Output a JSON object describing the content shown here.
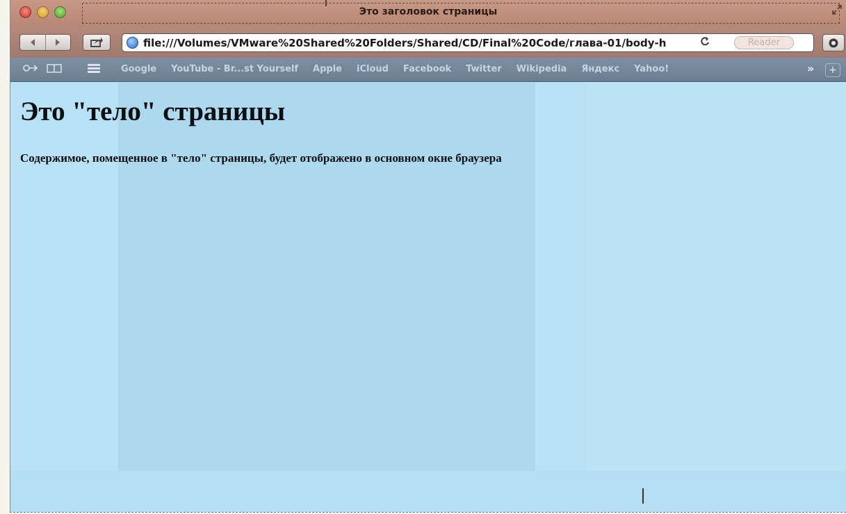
{
  "window": {
    "title": "Это заголовок страницы"
  },
  "toolbar": {
    "back_icon": "back-arrow-icon",
    "forward_icon": "forward-arrow-icon",
    "share_icon": "share-icon",
    "url": "file:///Volumes/VMware%20Shared%20Folders/Shared/CD/Final%20Code/глава-01/body-h",
    "reload_icon": "reload-icon",
    "reader_label": "Reader",
    "extra_icon": "download-icon"
  },
  "bookmarks": {
    "items": [
      {
        "label": "Google"
      },
      {
        "label": "YouTube - Br...st Yourself"
      },
      {
        "label": "Apple"
      },
      {
        "label": "iCloud"
      },
      {
        "label": "Facebook"
      },
      {
        "label": "Twitter"
      },
      {
        "label": "Wikipedia"
      },
      {
        "label": "Яндекс"
      },
      {
        "label": "Yahoo!"
      }
    ],
    "more_label": "»",
    "plus_label": "+"
  },
  "page": {
    "heading": "Это \"тело\" страницы",
    "paragraph": "Содержимое, помещенное в \"тело\" страницы, будет отображено в основном окне браузера"
  },
  "colors": {
    "content_bg": "#b9e2f5",
    "titlebar_bg": "#c79a86",
    "bookmarks_bg": "#7e90a3"
  }
}
